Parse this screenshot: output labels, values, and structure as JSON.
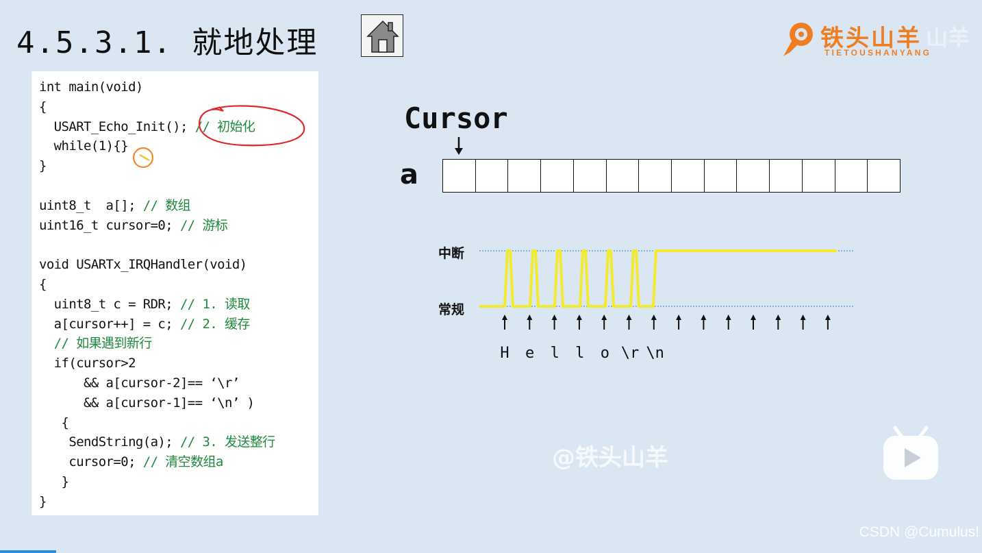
{
  "slide": {
    "title": "4.5.3.1. 就地处理",
    "home_icon": "home-icon"
  },
  "logo": {
    "main": "铁头山羊",
    "sub": "TIETOUSHANYANG",
    "ghost": "山羊",
    "icon": "ram-icon",
    "color": "#ef7d22"
  },
  "code": {
    "lines": [
      {
        "code": "int main(void)",
        "comment": ""
      },
      {
        "code": "{",
        "comment": ""
      },
      {
        "code": "  USART_Echo_Init();",
        "comment": " // 初始化"
      },
      {
        "code": "  while(1){}",
        "comment": ""
      },
      {
        "code": "}",
        "comment": ""
      },
      {
        "code": "",
        "comment": ""
      },
      {
        "code": "uint8_t  a[];",
        "comment": " // 数组"
      },
      {
        "code": "uint16_t cursor=0;",
        "comment": " // 游标"
      },
      {
        "code": "",
        "comment": ""
      },
      {
        "code": "void USARTx_IRQHandler(void)",
        "comment": ""
      },
      {
        "code": "{",
        "comment": ""
      },
      {
        "code": "  uint8_t c = RDR;",
        "comment": " // 1. 读取"
      },
      {
        "code": "  a[cursor++] = c;",
        "comment": " // 2. 缓存"
      },
      {
        "code": "  ",
        "comment": "// 如果遇到新行"
      },
      {
        "code": "  if(cursor>2",
        "comment": ""
      },
      {
        "code": "      && a[cursor-2]== ‘\\r’",
        "comment": ""
      },
      {
        "code": "      && a[cursor-1]== ‘\\n’ )",
        "comment": ""
      },
      {
        "code": "   {",
        "comment": ""
      },
      {
        "code": "    SendString(a);",
        "comment": " // 3. 发送整行"
      },
      {
        "code": "    cursor=0;",
        "comment": " // 清空数组a"
      },
      {
        "code": "   }",
        "comment": ""
      },
      {
        "code": "}",
        "comment": ""
      }
    ],
    "comment_color": "#1f8a3a",
    "annotation_color": "#e0282a"
  },
  "diagram": {
    "cursor_label": "Cursor",
    "array_name": "a",
    "array_cells": 14,
    "interrupt_label": "中断",
    "normal_label": "常规",
    "signal_color": "#f2ea2c",
    "pulse_count": 6,
    "bytes": [
      "H",
      "e",
      "l",
      "l",
      "o",
      "\\r",
      "\\n"
    ],
    "arrow_count": 14
  },
  "player": {
    "watermark": "@铁头山羊",
    "play_icon": "play-icon",
    "credit": "CSDN @Cumulus!",
    "progress_color": "#2a8ce6"
  }
}
